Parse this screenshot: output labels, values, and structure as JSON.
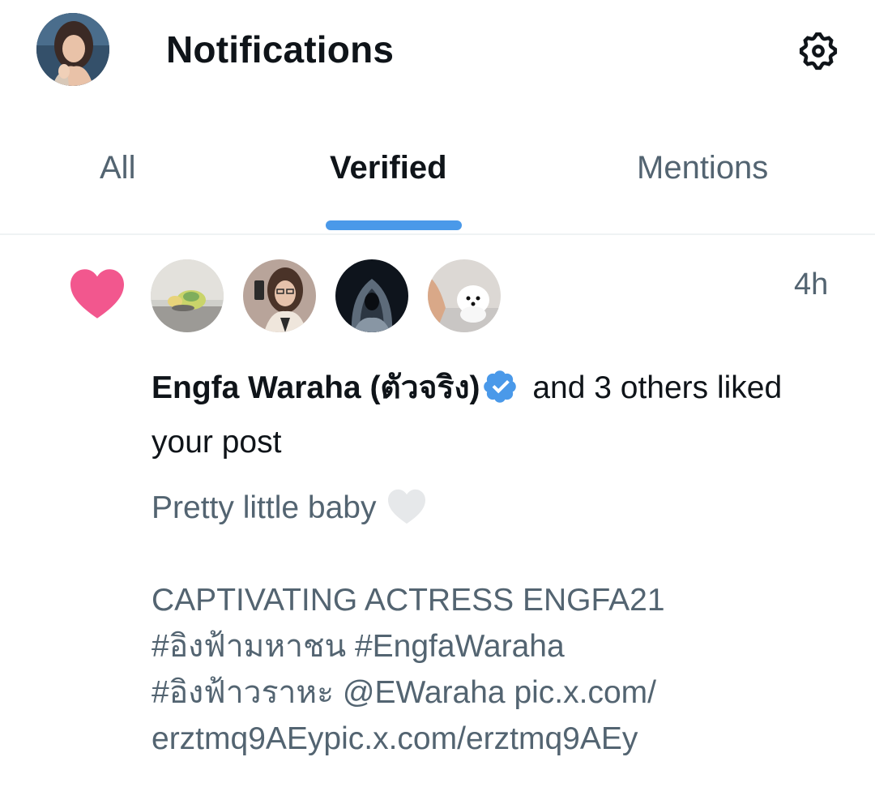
{
  "header": {
    "title": "Notifications",
    "avatar_icon": "profile-avatar",
    "settings_icon": "gear-icon"
  },
  "tabs": [
    {
      "label": "All",
      "active": false
    },
    {
      "label": "Verified",
      "active": true
    },
    {
      "label": "Mentions",
      "active": false
    }
  ],
  "notification": {
    "type_icon": "heart-icon",
    "icon_color": "#f2578e",
    "likers": [
      "turtle-plush-avatar",
      "woman-glasses-avatar",
      "hooded-figure-avatar",
      "white-puppy-avatar"
    ],
    "time": "4h",
    "user_name": "Engfa Waraha (ตัวจริง)",
    "verified_icon": "verified-badge-icon",
    "summary_suffix": " and 3 others liked your post",
    "post_lines": [
      "Pretty little baby",
      "",
      "CAPTIVATING ACTRESS ENGFA21",
      "#อิงฟ้ามหาชน #EngfaWaraha",
      "#อิงฟ้าวราหะ @EWaraha pic.x.com/",
      "erztmq9AEypic.x.com/erztmq9AEy"
    ]
  },
  "colors": {
    "accent": "#4a99e9",
    "text_primary": "#0f1419",
    "text_secondary": "#536471",
    "like": "#f2578e"
  }
}
